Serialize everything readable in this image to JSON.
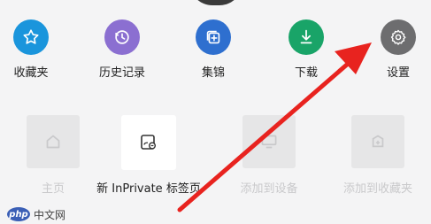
{
  "quick_actions": [
    {
      "label": "收藏夹",
      "icon": "star-icon",
      "color": "#1a95dc"
    },
    {
      "label": "历史记录",
      "icon": "history-icon",
      "color": "#8b6fd1"
    },
    {
      "label": "集锦",
      "icon": "collections-icon",
      "color": "#2e6fcf"
    },
    {
      "label": "下载",
      "icon": "download-icon",
      "color": "#19a468"
    },
    {
      "label": "设置",
      "icon": "gear-icon",
      "color": "#6d6d6f"
    }
  ],
  "secondary_actions": [
    {
      "label": "主页",
      "icon": "home-icon",
      "state": "disabled"
    },
    {
      "label": "新 InPrivate 标签页",
      "icon": "inprivate-tab-icon",
      "state": "enabled"
    },
    {
      "label": "添加到设备",
      "icon": "device-icon",
      "state": "disabled"
    },
    {
      "label": "添加到收藏夹",
      "icon": "favorite-add-icon",
      "state": "disabled"
    }
  ],
  "annotation": {
    "arrow_color": "#e8231f",
    "points_to": "设置"
  },
  "watermark": {
    "logo": "php",
    "text": "中文网"
  }
}
